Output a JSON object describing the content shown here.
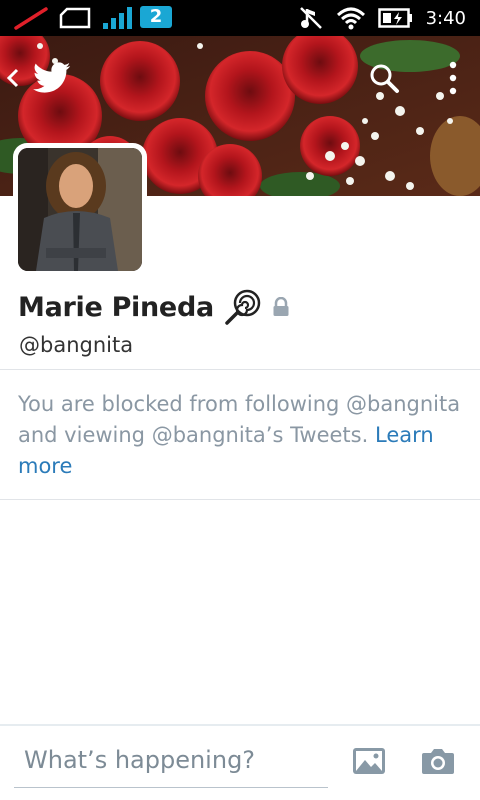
{
  "status_bar": {
    "sim_badge": "2",
    "time": "3:40"
  },
  "header": {
    "back_icon": "chevron-left-icon",
    "logo_icon": "twitter-bird-icon",
    "search_icon": "search-icon",
    "menu_icon": "overflow-menu-icon"
  },
  "profile": {
    "name": "Marie Pineda",
    "name_emoji": "lollipop-icon",
    "protected_icon": "lock-icon",
    "handle": "@bangnita"
  },
  "blocked_notice": {
    "text": "You are blocked from following @bangnita and viewing @bangnita’s Tweets.",
    "link": "Learn more"
  },
  "compose": {
    "placeholder": "What’s happening?",
    "photo_icon": "image-icon",
    "camera_icon": "camera-icon"
  },
  "colors": {
    "link": "#2b7bb9",
    "muted_text": "#8a97a3",
    "sim_badge": "#1aa7d4"
  }
}
